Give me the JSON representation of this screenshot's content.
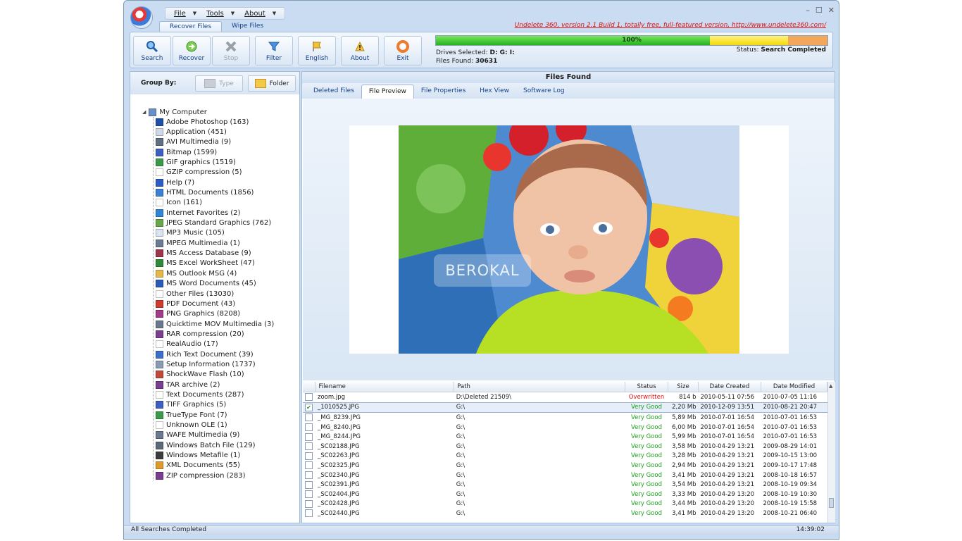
{
  "app": {
    "version_text": "Undelete 360, version 2.1 Build 1, totally free, full-featured version, http://www.undelete360.com/"
  },
  "menu": [
    {
      "label": "File"
    },
    {
      "label": "Tools"
    },
    {
      "label": "About"
    }
  ],
  "ribbon_tabs": [
    {
      "label": "Recover Files",
      "active": true
    },
    {
      "label": "Wipe Files",
      "active": false
    }
  ],
  "toolbar": {
    "search": "Search",
    "recover": "Recover",
    "stop": "Stop",
    "filter": "Filter",
    "english": "English",
    "about": "About",
    "exit": "Exit"
  },
  "progress": {
    "label": "100%",
    "value": 100
  },
  "drives": {
    "label": "Drives Selected:",
    "value": "D: G: I:"
  },
  "files_found": {
    "label": "Files Found:",
    "value": "30631"
  },
  "status": {
    "label": "Status:",
    "value": "Search Completed"
  },
  "group_by": {
    "label": "Group By:",
    "type": "Type",
    "folder": "Folder"
  },
  "tree": {
    "root": "My Computer",
    "items": [
      {
        "label": "Adobe Photoshop (163)",
        "color": "#1f4fa8"
      },
      {
        "label": "Application (451)",
        "color": "#cfd8e6"
      },
      {
        "label": "AVI Multimedia (9)",
        "color": "#5f6f86"
      },
      {
        "label": "Bitmap (1599)",
        "color": "#3d5fc4"
      },
      {
        "label": "GIF graphics (1519)",
        "color": "#3a9a4a"
      },
      {
        "label": "GZIP compression (5)",
        "color": "#ffffff"
      },
      {
        "label": "Help (7)",
        "color": "#2e5cc7"
      },
      {
        "label": "HTML Documents (1856)",
        "color": "#3b7fd6"
      },
      {
        "label": "Icon (161)",
        "color": "#ffffff"
      },
      {
        "label": "Internet Favorites (2)",
        "color": "#2f86d8"
      },
      {
        "label": "JPEG Standard Graphics (762)",
        "color": "#6aa64a"
      },
      {
        "label": "MP3 Music (105)",
        "color": "#d9e3f2"
      },
      {
        "label": "MPEG Multimedia (1)",
        "color": "#6b7b93"
      },
      {
        "label": "MS Access Database (9)",
        "color": "#a0344a"
      },
      {
        "label": "MS Excel WorkSheet (47)",
        "color": "#2f8a3a"
      },
      {
        "label": "MS Outlook MSG (4)",
        "color": "#e3b94a"
      },
      {
        "label": "MS Word Documents (45)",
        "color": "#2b5ab8"
      },
      {
        "label": "Other Files (13030)",
        "color": "#ffffff"
      },
      {
        "label": "PDF Document (43)",
        "color": "#d33a2f"
      },
      {
        "label": "PNG Graphics (8208)",
        "color": "#a33a8a"
      },
      {
        "label": "Quicktime MOV Multimedia (3)",
        "color": "#6a7890"
      },
      {
        "label": "RAR compression (20)",
        "color": "#7a3d8f"
      },
      {
        "label": "RealAudio (17)",
        "color": "#ffffff"
      },
      {
        "label": "Rich Text Document (39)",
        "color": "#3b6fc9"
      },
      {
        "label": "Setup Information (1737)",
        "color": "#8a9bb3"
      },
      {
        "label": "ShockWave Flash (10)",
        "color": "#c24a3a"
      },
      {
        "label": "TAR archive (2)",
        "color": "#7a3d8f"
      },
      {
        "label": "Text Documents (287)",
        "color": "#ffffff"
      },
      {
        "label": "TIFF Graphics (5)",
        "color": "#3d5fc4"
      },
      {
        "label": "TrueType Font (7)",
        "color": "#3a9a4a"
      },
      {
        "label": "Unknown OLE (1)",
        "color": "#ffffff"
      },
      {
        "label": "WAFE Multimedia (9)",
        "color": "#6a7890"
      },
      {
        "label": "Windows Batch File (129)",
        "color": "#5a6a7a"
      },
      {
        "label": "Windows Metafile (1)",
        "color": "#3c3c3c"
      },
      {
        "label": "XML Documents (55)",
        "color": "#e09a2a"
      },
      {
        "label": "ZIP compression (283)",
        "color": "#7a3d8f"
      }
    ]
  },
  "panel_title": "Files Found",
  "preview_tabs": [
    {
      "label": "Deleted Files",
      "active": false
    },
    {
      "label": "File Preview",
      "active": true
    },
    {
      "label": "File Properties",
      "active": false
    },
    {
      "label": "Hex View",
      "active": false
    },
    {
      "label": "Software Log",
      "active": false
    }
  ],
  "watermark": "BEROKAL",
  "table": {
    "columns": [
      "Filename",
      "Path",
      "Status",
      "Size",
      "Date Created",
      "Date Modified"
    ],
    "rows": [
      {
        "checked": false,
        "filename": "zoom.jpg",
        "path": "D:\\Deleted 21509\\",
        "status": "Overwritten",
        "size": "814 b",
        "created": "2010-05-11 07:56",
        "modified": "2010-07-05 11:16"
      },
      {
        "checked": true,
        "selected": true,
        "filename": "_1010525.JPG",
        "path": "G:\\",
        "status": "Very Good",
        "size": "2,20 Mb",
        "created": "2010-12-09 13:51",
        "modified": "2010-08-21 20:47"
      },
      {
        "checked": false,
        "filename": "_MG_8239.JPG",
        "path": "G:\\",
        "status": "Very Good",
        "size": "5,89 Mb",
        "created": "2010-07-01 16:54",
        "modified": "2010-07-01 16:53"
      },
      {
        "checked": false,
        "filename": "_MG_8240.JPG",
        "path": "G:\\",
        "status": "Very Good",
        "size": "6,00 Mb",
        "created": "2010-07-01 16:54",
        "modified": "2010-07-01 16:53"
      },
      {
        "checked": false,
        "filename": "_MG_8244.JPG",
        "path": "G:\\",
        "status": "Very Good",
        "size": "5,99 Mb",
        "created": "2010-07-01 16:54",
        "modified": "2010-07-01 16:53"
      },
      {
        "checked": false,
        "filename": "_SC02188.JPG",
        "path": "G:\\",
        "status": "Very Good",
        "size": "3,58 Mb",
        "created": "2010-04-29 13:21",
        "modified": "2009-08-29 14:01"
      },
      {
        "checked": false,
        "filename": "_SC02263.JPG",
        "path": "G:\\",
        "status": "Very Good",
        "size": "3,28 Mb",
        "created": "2010-04-29 13:21",
        "modified": "2009-10-15 13:00"
      },
      {
        "checked": false,
        "filename": "_SC02325.JPG",
        "path": "G:\\",
        "status": "Very Good",
        "size": "2,94 Mb",
        "created": "2010-04-29 13:21",
        "modified": "2009-10-17 17:48"
      },
      {
        "checked": false,
        "filename": "_SC02340.JPG",
        "path": "G:\\",
        "status": "Very Good",
        "size": "3,41 Mb",
        "created": "2010-04-29 13:21",
        "modified": "2008-10-18 16:57"
      },
      {
        "checked": false,
        "filename": "_SC02391.JPG",
        "path": "G:\\",
        "status": "Very Good",
        "size": "3,54 Mb",
        "created": "2010-04-29 13:21",
        "modified": "2008-10-19 09:34"
      },
      {
        "checked": false,
        "filename": "_SC02404.JPG",
        "path": "G:\\",
        "status": "Very Good",
        "size": "3,33 Mb",
        "created": "2010-04-29 13:20",
        "modified": "2008-10-19 10:30"
      },
      {
        "checked": false,
        "filename": "_SC02428.JPG",
        "path": "G:\\",
        "status": "Very Good",
        "size": "3,44 Mb",
        "created": "2010-04-29 13:20",
        "modified": "2008-10-19 15:58"
      },
      {
        "checked": false,
        "filename": "_SC02440.JPG",
        "path": "G:\\",
        "status": "Very Good",
        "size": "3,41 Mb",
        "created": "2010-04-29 13:20",
        "modified": "2008-10-21 06:40"
      }
    ]
  },
  "statusbar": {
    "left": "All Searches Completed",
    "time": "14:39:02"
  }
}
